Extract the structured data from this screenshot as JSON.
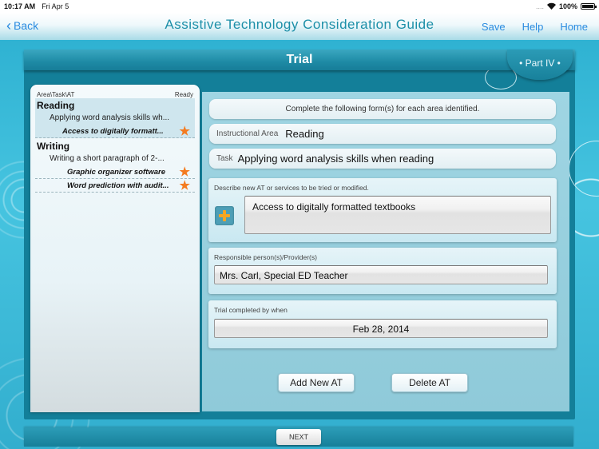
{
  "status_bar": {
    "time": "10:17 AM",
    "date": "Fri Apr 5",
    "signal": "....",
    "battery": "100%"
  },
  "nav": {
    "back_label": "Back",
    "title": "Assistive Technology Consideration Guide",
    "actions": [
      "Save",
      "Help",
      "Home"
    ]
  },
  "page": {
    "title": "Trial",
    "part_label": "• Part IV •"
  },
  "left_list": {
    "header_left": "Area\\Task\\AT",
    "header_right": "Ready",
    "areas": [
      {
        "area": "Reading",
        "task": "Applying word analysis skills wh...",
        "ats": [
          {
            "label": "Access to digitally formatt...",
            "ready": true
          }
        ]
      },
      {
        "area": "Writing",
        "task": "Writing a short paragraph of 2-...",
        "ats": [
          {
            "label": "Graphic organizer software",
            "ready": true
          },
          {
            "label": "Word prediction with audit...",
            "ready": true
          }
        ]
      }
    ]
  },
  "form": {
    "instruction": "Complete the following form(s) for each area identified.",
    "instructional_area_label": "Instructional Area",
    "instructional_area_value": "Reading",
    "task_label": "Task",
    "task_value": "Applying word analysis skills when reading",
    "describe_label": "Describe new AT or services to be tried or modified.",
    "describe_value": "Access to digitally formatted textbooks",
    "responsible_label": "Responsible person(s)/Provider(s)",
    "responsible_value": "Mrs. Carl, Special ED Teacher",
    "trial_label": "Trial completed by when",
    "trial_value": "Feb 28, 2014",
    "add_button": "Add New AT",
    "delete_button": "Delete AT"
  },
  "footer": {
    "next_label": "NEXT"
  },
  "colors": {
    "accent": "#2a8be0",
    "star": "#f47b20",
    "plus": "#f5a623",
    "teal": "#177f99"
  }
}
